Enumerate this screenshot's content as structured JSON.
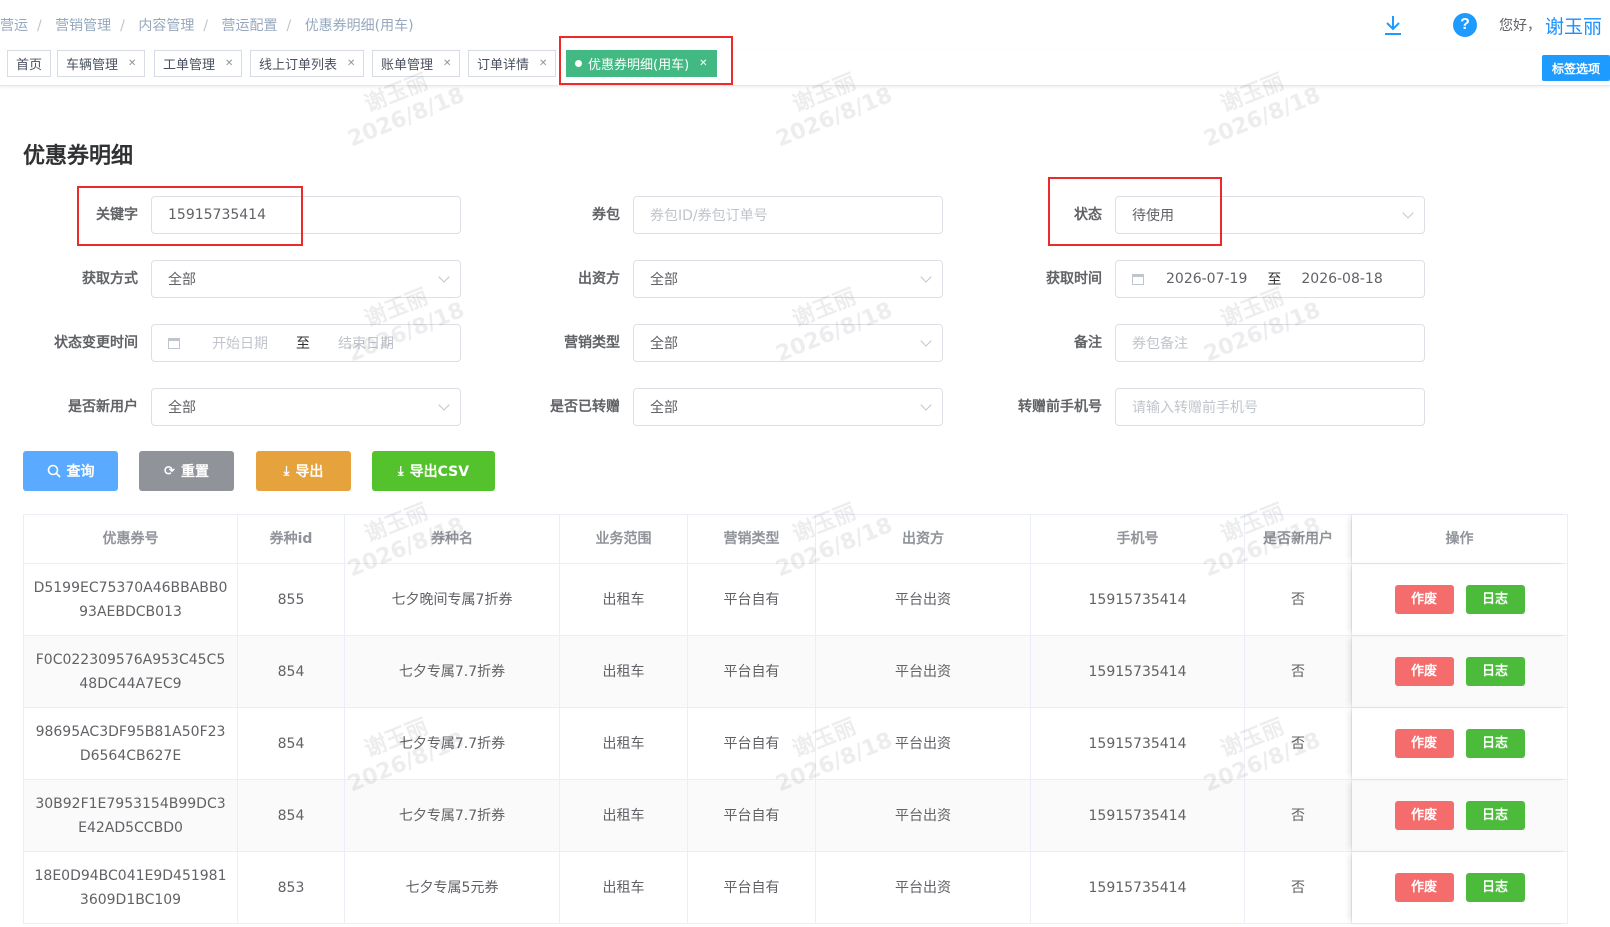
{
  "breadcrumb": [
    "营运",
    "营销管理",
    "内容管理",
    "营运配置",
    "优惠券明细(用车)"
  ],
  "header": {
    "greeting": "您好，",
    "user_name": "谢玉丽",
    "help_glyph": "?"
  },
  "tags": [
    "首页",
    "车辆管理",
    "工单管理",
    "线上订单列表",
    "账单管理",
    "订单详情",
    "优惠券明细(用车)"
  ],
  "tag_options_label": "标签选项",
  "watermark": {
    "name": "谢玉丽",
    "date": "2026/8/18"
  },
  "page_title": "优惠券明细",
  "form": {
    "keyword": {
      "label": "关键字",
      "value": "15915735414"
    },
    "package": {
      "label": "券包",
      "placeholder": "券包ID/券包订单号"
    },
    "status": {
      "label": "状态",
      "value": "待使用"
    },
    "acquire_method": {
      "label": "获取方式",
      "value": "全部"
    },
    "funder": {
      "label": "出资方",
      "value": "全部"
    },
    "acquire_time": {
      "label": "获取时间",
      "start": "2026-07-19",
      "sep": "至",
      "end": "2026-08-18"
    },
    "status_change_time": {
      "label": "状态变更时间",
      "start_placeholder": "开始日期",
      "sep": "至",
      "end_placeholder": "结束日期"
    },
    "marketing_type": {
      "label": "营销类型",
      "value": "全部"
    },
    "remark": {
      "label": "备注",
      "placeholder": "券包备注"
    },
    "is_new_user": {
      "label": "是否新用户",
      "value": "全部"
    },
    "is_transferred": {
      "label": "是否已转赠",
      "value": "全部"
    },
    "pre_transfer_phone": {
      "label": "转赠前手机号",
      "placeholder": "请输入转赠前手机号"
    }
  },
  "buttons": {
    "query": "查询",
    "reset": "重置",
    "export": "导出",
    "export_csv": "导出CSV"
  },
  "colors": {
    "query": "#5aabff",
    "reset": "#909399",
    "export": "#e6a23c",
    "export_csv": "#53c22c",
    "active_tag": "#42b983",
    "highlight": "#ec2a2a"
  },
  "table": {
    "headers": [
      "优惠券号",
      "券种id",
      "券种名",
      "业务范围",
      "营销类型",
      "出资方",
      "手机号",
      "是否新用户",
      "操作"
    ],
    "rows": [
      {
        "coupon_no": "D5199EC75370A46BBABB0\n93AEBDCB013",
        "type_id": "855",
        "type_name": "七夕晚间专属7折券",
        "scope": "出租车",
        "mkt_type": "平台自有",
        "funder": "平台出资",
        "phone": "15915735414",
        "new_user": "否"
      },
      {
        "coupon_no": "F0C022309576A953C45C5\n48DC44A7EC9",
        "type_id": "854",
        "type_name": "七夕专属7.7折券",
        "scope": "出租车",
        "mkt_type": "平台自有",
        "funder": "平台出资",
        "phone": "15915735414",
        "new_user": "否"
      },
      {
        "coupon_no": "98695AC3DF95B81A50F23\nD6564CB627E",
        "type_id": "854",
        "type_name": "七夕专属7.7折券",
        "scope": "出租车",
        "mkt_type": "平台自有",
        "funder": "平台出资",
        "phone": "15915735414",
        "new_user": "否"
      },
      {
        "coupon_no": "30B92F1E7953154B99DC3\nE42AD5CCBD0",
        "type_id": "854",
        "type_name": "七夕专属7.7折券",
        "scope": "出租车",
        "mkt_type": "平台自有",
        "funder": "平台出资",
        "phone": "15915735414",
        "new_user": "否"
      },
      {
        "coupon_no": "18E0D94BC041E9D451981\n3609D1BC109",
        "type_id": "853",
        "type_name": "七夕专属5元券",
        "scope": "出租车",
        "mkt_type": "平台自有",
        "funder": "平台出资",
        "phone": "15915735414",
        "new_user": "否"
      }
    ],
    "actions": {
      "void": "作废",
      "log": "日志"
    }
  }
}
